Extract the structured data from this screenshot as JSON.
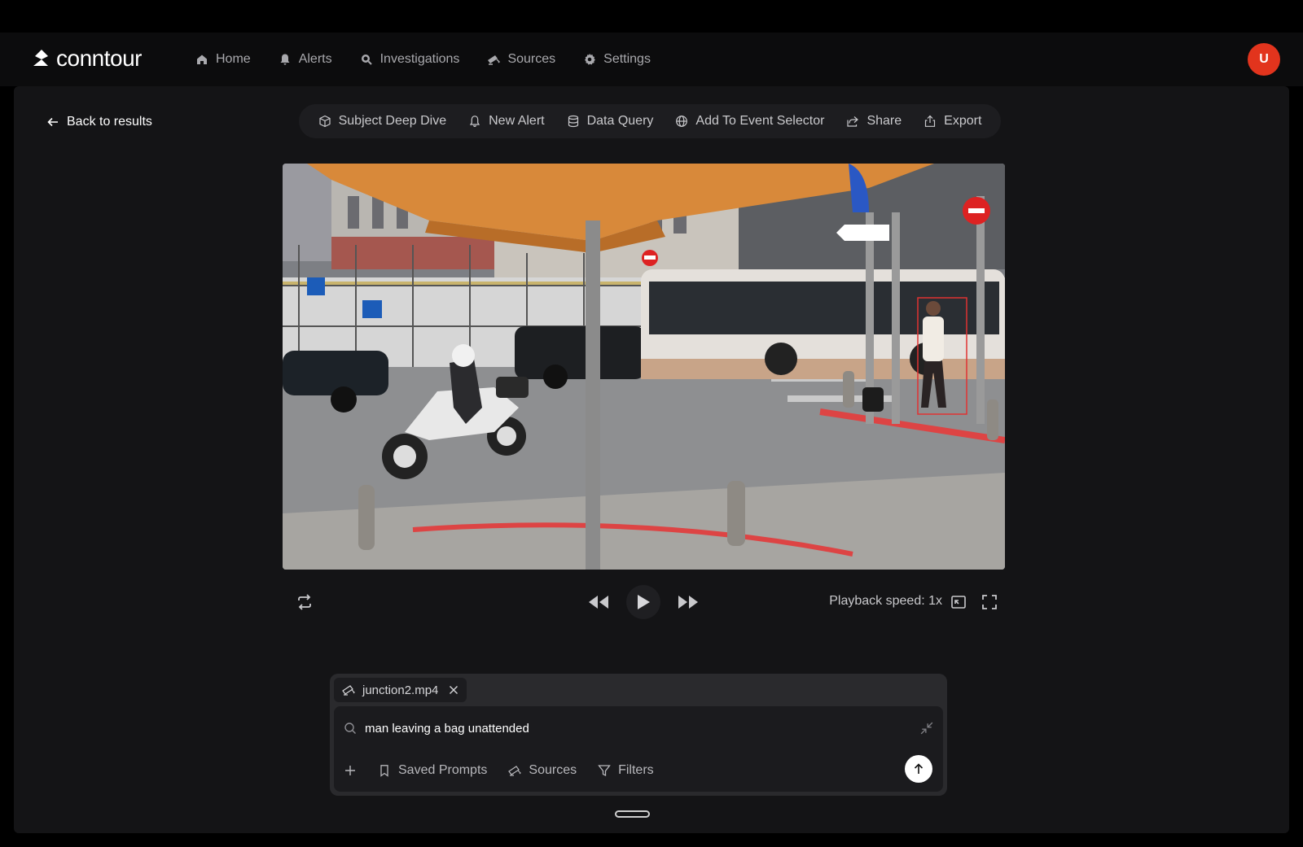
{
  "app": {
    "name": "conntour"
  },
  "nav": {
    "items": [
      {
        "label": "Home",
        "icon": "home-icon"
      },
      {
        "label": "Alerts",
        "icon": "bell-icon"
      },
      {
        "label": "Investigations",
        "icon": "investigation-icon"
      },
      {
        "label": "Sources",
        "icon": "camera-icon"
      },
      {
        "label": "Settings",
        "icon": "gear-icon"
      }
    ],
    "avatar_initial": "U"
  },
  "page": {
    "back_label": "Back to results"
  },
  "toolbar": {
    "items": [
      {
        "label": "Subject Deep Dive",
        "icon": "cube-icon"
      },
      {
        "label": "New Alert",
        "icon": "bell-outline-icon"
      },
      {
        "label": "Data Query",
        "icon": "database-icon"
      },
      {
        "label": "Add To Event Selector",
        "icon": "globe-icon"
      },
      {
        "label": "Share",
        "icon": "share-icon"
      },
      {
        "label": "Export",
        "icon": "export-icon"
      }
    ]
  },
  "player": {
    "playback_speed_label": "Playback speed: 1x"
  },
  "query": {
    "source_chip": "junction2.mp4",
    "search_value": "man leaving a bag unattended",
    "saved_prompts_label": "Saved Prompts",
    "sources_label": "Sources",
    "filters_label": "Filters"
  },
  "colors": {
    "accent_avatar": "#e2341d",
    "background": "#141416",
    "detection_box": "#e03232"
  }
}
